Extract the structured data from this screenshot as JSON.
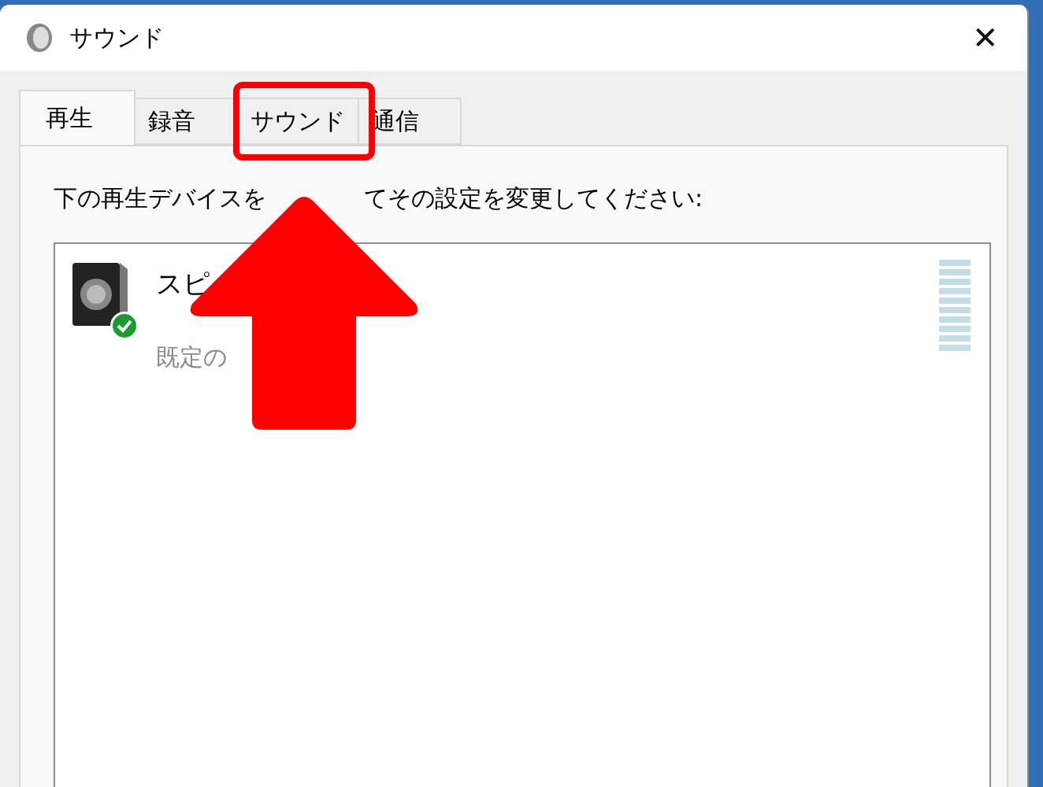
{
  "window": {
    "title": "サウンド",
    "close": "✕"
  },
  "tabs": [
    {
      "label": "再生",
      "selected": true
    },
    {
      "label": "録音",
      "selected": false
    },
    {
      "label": "サウンド",
      "selected": false,
      "highlighted": true
    },
    {
      "label": "通信",
      "selected": false
    }
  ],
  "instruction": {
    "before": "下の再生デバイスを",
    "after": "てその設定を変更してください:"
  },
  "devices": [
    {
      "name": "スピ",
      "status": "既定の",
      "default": true,
      "level": 0
    }
  ],
  "annotation": {
    "kind": "up-arrow"
  }
}
